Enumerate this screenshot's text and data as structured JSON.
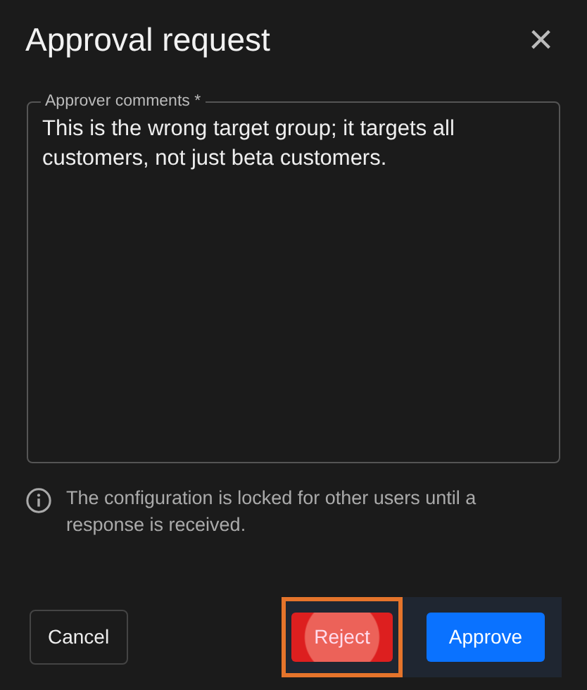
{
  "dialog": {
    "title": "Approval request",
    "close": "×"
  },
  "comments": {
    "label": "Approver comments *",
    "value": "This is the wrong target group; it targets all customers, not just beta customers."
  },
  "info": "The configuration is locked for other users until a response is received.",
  "buttons": [
    {
      "kind": "outline",
      "label": "Cancel",
      "highlighted": false
    },
    {
      "kind": "danger",
      "label": "Reject",
      "highlighted": true
    },
    {
      "kind": "primary",
      "label": "Approve",
      "highlighted": false
    }
  ]
}
